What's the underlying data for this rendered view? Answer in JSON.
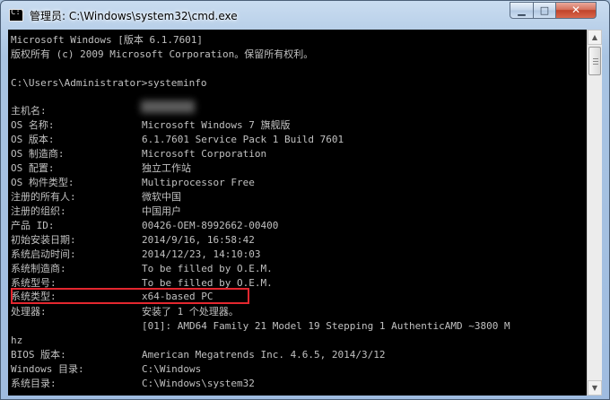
{
  "window": {
    "title": "管理员: C:\\Windows\\system32\\cmd.exe",
    "icon_text": "C:\\",
    "controls": {
      "minimize": "▁",
      "maximize": "□",
      "close": "✕"
    }
  },
  "console": {
    "header1": "Microsoft Windows [版本 6.1.7601]",
    "header2": "版权所有 (c) 2009 Microsoft Corporation。保留所有权利。",
    "prompt": "C:\\Users\\Administrator>systeminfo",
    "rows": [
      {
        "label": "主机名:",
        "value": ""
      },
      {
        "label": "OS 名称:",
        "value": "Microsoft Windows 7 旗舰版"
      },
      {
        "label": "OS 版本:",
        "value": "6.1.7601 Service Pack 1 Build 7601"
      },
      {
        "label": "OS 制造商:",
        "value": "Microsoft Corporation"
      },
      {
        "label": "OS 配置:",
        "value": "独立工作站"
      },
      {
        "label": "OS 构件类型:",
        "value": "Multiprocessor Free"
      },
      {
        "label": "注册的所有人:",
        "value": "微软中国"
      },
      {
        "label": "注册的组织:",
        "value": "中国用户"
      },
      {
        "label": "产品 ID:",
        "value": "00426-OEM-8992662-00400"
      },
      {
        "label": "初始安装日期:",
        "value": "2014/9/16, 16:58:42"
      },
      {
        "label": "系统启动时间:",
        "value": "2014/12/23, 14:10:03"
      },
      {
        "label": "系统制造商:",
        "value": "To be filled by O.E.M."
      },
      {
        "label": "系统型号:",
        "value": "To be filled by O.E.M."
      },
      {
        "label": "系统类型:",
        "value": "x64-based PC"
      },
      {
        "label": "处理器:",
        "value": "安装了 1 个处理器。"
      },
      {
        "label": "",
        "value": "[01]: AMD64 Family 21 Model 19 Stepping 1 AuthenticAMD ~3800 M"
      },
      {
        "label": "hz",
        "value": ""
      },
      {
        "label": "BIOS 版本:",
        "value": "American Megatrends Inc. 4.6.5, 2014/3/12"
      },
      {
        "label": "Windows 目录:",
        "value": "C:\\Windows"
      },
      {
        "label": "系统目录:",
        "value": "C:\\Windows\\system32"
      }
    ]
  },
  "colors": {
    "console_bg": "#000000",
    "console_text": "#c0c0c0",
    "highlight": "#e4272f"
  }
}
